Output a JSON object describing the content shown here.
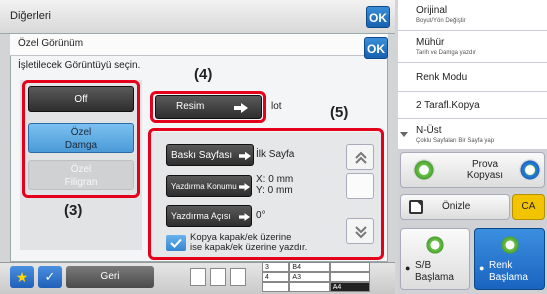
{
  "top_bar": {
    "title": "Diğerleri",
    "ok_label": "OK"
  },
  "right_panel": {
    "items": [
      {
        "label": "Orijinal",
        "sub": "Boyut/Yön Değiştir"
      },
      {
        "label": "Mühür",
        "sub": "Tarih ve Damga yazdır"
      },
      {
        "label": "Renk Modu",
        "sub": ""
      },
      {
        "label": "2 Tarafl.Kopya",
        "sub": ""
      },
      {
        "label": "N-Üst",
        "sub": "Çoklu Sayfaları Bir Sayfa yap"
      }
    ]
  },
  "actions": {
    "prova_label": "Prova Kopyası",
    "onizle_label": "Önizle",
    "ca_label": "CA",
    "sb_label_1": "S/B",
    "sb_label_2": "Başlama",
    "renk_label_1": "Renk",
    "renk_label_2": "Başlama"
  },
  "footer": {
    "back_label": "Geri",
    "paper_rows": [
      {
        "num": "3",
        "size": "B4"
      },
      {
        "num": "4",
        "size": "A3"
      }
    ],
    "paper_selected": "A4"
  },
  "dialog": {
    "title": "Özel Görünüm",
    "ok_label": "OK",
    "instruction": "İşletilecek Görüntüyü seçin.",
    "options": {
      "off": "Off",
      "damga_line1": "Özel",
      "damga_line2": "Damga",
      "filigran_line1": "Özel",
      "filigran_line2": "Filigran"
    },
    "resim_label": "Resim",
    "lot_text": "lot",
    "settings": {
      "print_page_label": "Baskı Sayfası",
      "print_page_value": "İlk Sayfa",
      "print_pos_label": "Yazdırma Konumu",
      "print_pos_x": "X: 0 mm",
      "print_pos_y": "Y: 0 mm",
      "print_angle_label": "Yazdırma Açısı",
      "print_angle_value": "0°",
      "cover_check_line1": "Kopya kapak/ek üzerine",
      "cover_check_line2": "ise kapak/ek üzerine yazdır."
    }
  },
  "annotations": {
    "n3": "(3)",
    "n4": "(4)",
    "n5": "(5)"
  },
  "colors": {
    "accent_blue": "#1a64c0",
    "highlight_red": "#e4001b",
    "ca_yellow": "#f2c400"
  }
}
